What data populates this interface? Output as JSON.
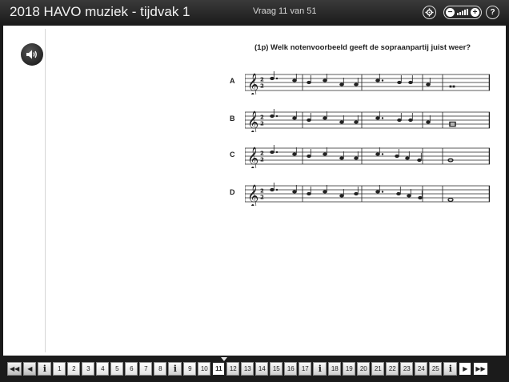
{
  "header": {
    "title": "2018 HAVO muziek - tijdvak 1",
    "question_counter": "Vraag 11 van 51",
    "zoom_minus": "−",
    "zoom_plus": "+",
    "help": "?"
  },
  "question": {
    "text": "(1p) Welk notenvoorbeeld geeft de sopraanpartij juist weer?",
    "options": [
      {
        "label": "A"
      },
      {
        "label": "B"
      },
      {
        "label": "C"
      },
      {
        "label": "D"
      }
    ]
  },
  "nav": {
    "first_icon": "double-left-icon",
    "prev_icon": "left-icon",
    "next_icon": "right-icon",
    "last_icon": "double-right-icon",
    "info_label": "i",
    "current_page": "11",
    "items": [
      "i",
      "1",
      "2",
      "3",
      "4",
      "5",
      "6",
      "7",
      "8",
      "i",
      "9",
      "10",
      "11",
      "12",
      "13",
      "14",
      "15",
      "16",
      "17",
      "i",
      "18",
      "19",
      "20",
      "21",
      "22",
      "23",
      "24",
      "25",
      "i"
    ]
  },
  "colors": {
    "header_bg": "#2a2a2a",
    "content_bg": "#ffffff",
    "footer_bg": "#1b1b1b"
  }
}
